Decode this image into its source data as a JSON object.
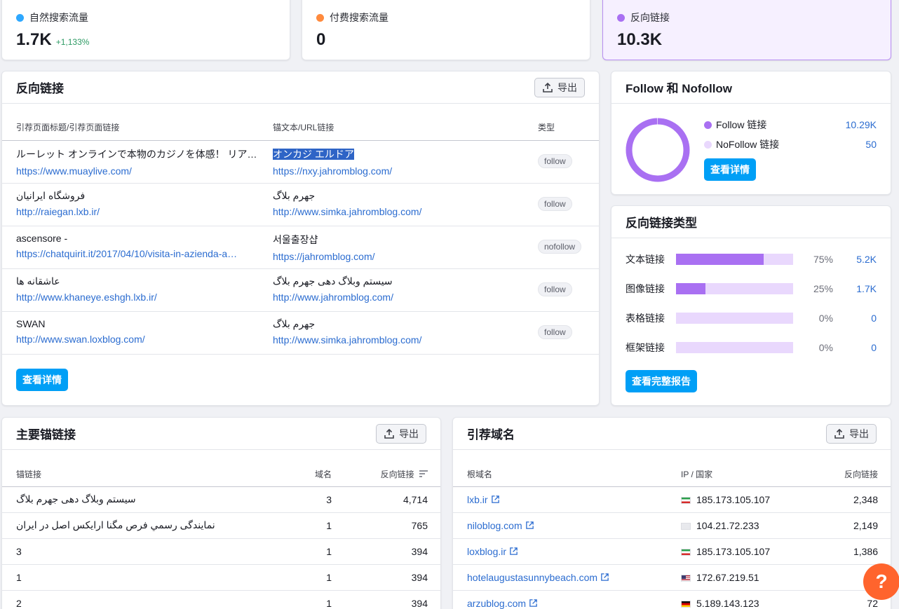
{
  "metrics": [
    {
      "label": "自然搜索流量",
      "value": "1.7K",
      "delta": "+1,133%",
      "color": "#2ea8ff"
    },
    {
      "label": "付费搜索流量",
      "value": "0",
      "delta": "",
      "color": "#ff8a3d"
    },
    {
      "label": "反向链接",
      "value": "10.3K",
      "delta": "",
      "color": "#a970f2"
    }
  ],
  "backlinks": {
    "title": "反向链接",
    "export_label": "导出",
    "columns": [
      "引荐页面标题/引荐页面链接",
      "锚文本/URL链接",
      "类型"
    ],
    "rows": [
      {
        "title": "ルーレット オンラインで本物のカジノを体感！ リア…",
        "url": "https://www.muaylive.com/",
        "anchor": "オンカジ エルドア",
        "anchor_url": "https://nxy.jahromblog.com/",
        "type": "follow"
      },
      {
        "title": "فروشگاه ایرانیان",
        "url": "http://raiegan.lxb.ir/",
        "anchor": "جهرم بلاگ",
        "anchor_url": "http://www.simka.jahromblog.com/",
        "type": "follow"
      },
      {
        "title": "ascensore -",
        "url": "https://chatquirit.it/2017/04/10/visita-in-azienda-a…",
        "anchor": "서울출장샵",
        "anchor_url": "https://jahromblog.com/",
        "type": "nofollow"
      },
      {
        "title": "عاشقانه ها",
        "url": "http://www.khaneye.eshgh.lxb.ir/",
        "anchor": "سیستم وبلاگ دهی جهرم بلاگ",
        "anchor_url": "http://www.jahromblog.com/",
        "type": "follow"
      },
      {
        "title": "SWAN",
        "url": "http://www.swan.loxblog.com/",
        "anchor": "جهرم بلاگ",
        "anchor_url": "http://www.simka.jahromblog.com/",
        "type": "follow"
      }
    ],
    "details_label": "查看详情"
  },
  "follow": {
    "title": "Follow 和 Nofollow",
    "items": [
      {
        "label": "Follow 链接",
        "value": "10.29K",
        "color": "#a970f2"
      },
      {
        "label": "NoFollow 链接",
        "value": "50",
        "color": "#e9d8fd"
      }
    ],
    "follow_fraction": 0.995,
    "details_label": "查看详情"
  },
  "types": {
    "title": "反向链接类型",
    "rows": [
      {
        "name": "文本链接",
        "pct": "75%",
        "fraction": 0.75,
        "count": "5.2K"
      },
      {
        "name": "图像链接",
        "pct": "25%",
        "fraction": 0.25,
        "count": "1.7K"
      },
      {
        "name": "表格链接",
        "pct": "0%",
        "fraction": 0,
        "count": "0"
      },
      {
        "name": "框架链接",
        "pct": "0%",
        "fraction": 0,
        "count": "0"
      }
    ],
    "report_label": "查看完整报告"
  },
  "anchors": {
    "title": "主要锚链接",
    "export_label": "导出",
    "columns": [
      "锚链接",
      "域名",
      "反向链接"
    ],
    "rows": [
      {
        "anchor": "سیستم وبلاگ دهی جهرم بلاگ",
        "domains": "3",
        "backlinks": "4,714"
      },
      {
        "anchor": "نمایندگی رسمي فرص مگنا ارایکس اصل در ایران",
        "domains": "1",
        "backlinks": "765"
      },
      {
        "anchor": "3",
        "domains": "1",
        "backlinks": "394"
      },
      {
        "anchor": "1",
        "domains": "1",
        "backlinks": "394"
      },
      {
        "anchor": "2",
        "domains": "1",
        "backlinks": "394"
      }
    ]
  },
  "referring": {
    "title": "引荐域名",
    "export_label": "导出",
    "columns": [
      "根域名",
      "IP / 国家",
      "反向链接"
    ],
    "rows": [
      {
        "domain": "lxb.ir",
        "flag": "ir",
        "ip": "185.173.105.107",
        "backlinks": "2,348"
      },
      {
        "domain": "niloblog.com",
        "flag": "none",
        "ip": "104.21.72.233",
        "backlinks": "2,149"
      },
      {
        "domain": "loxblog.ir",
        "flag": "ir",
        "ip": "185.173.105.107",
        "backlinks": "1,386"
      },
      {
        "domain": "hotelaugustasunnybeach.com",
        "flag": "us",
        "ip": "172.67.219.51",
        "backlinks": ""
      },
      {
        "domain": "arzublog.com",
        "flag": "de",
        "ip": "5.189.143.123",
        "backlinks": "72"
      }
    ]
  },
  "help_label": "?"
}
